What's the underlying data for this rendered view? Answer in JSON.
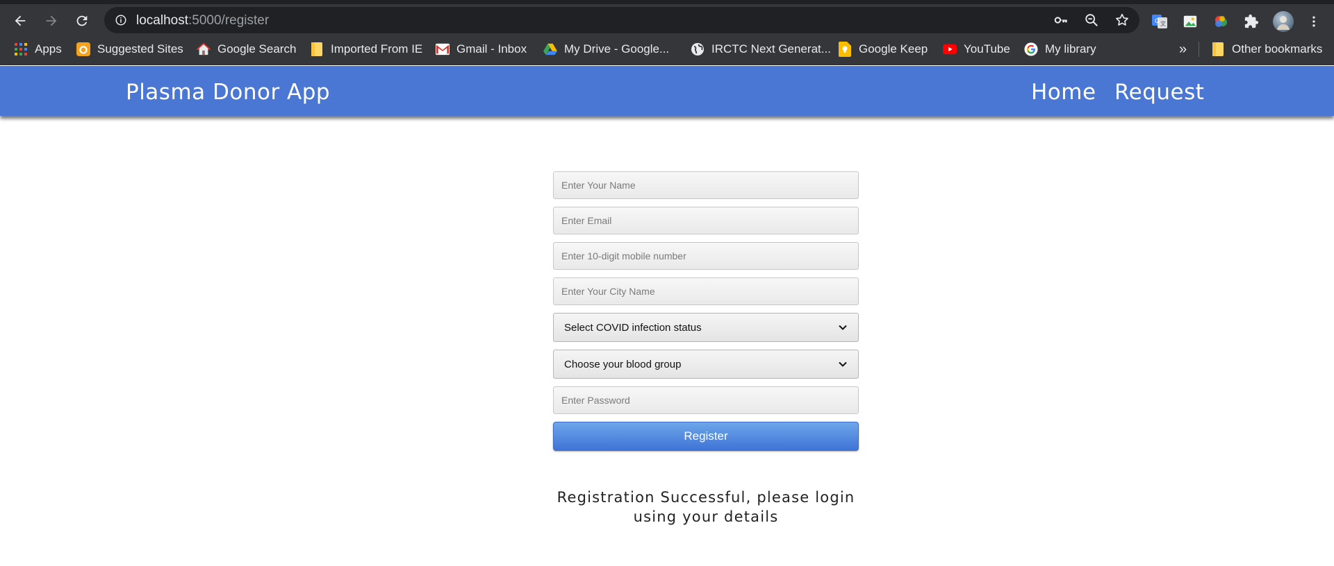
{
  "browser": {
    "url_host": "localhost",
    "url_path": ":5000/register"
  },
  "bookmarks": {
    "items": [
      {
        "label": "Apps",
        "icon": "apps-grid-icon"
      },
      {
        "label": "Suggested Sites",
        "icon": "bing-icon"
      },
      {
        "label": "Google Search",
        "icon": "home-icon"
      },
      {
        "label": "Imported From IE",
        "icon": "folder-icon"
      },
      {
        "label": "Gmail - Inbox",
        "icon": "gmail-icon"
      },
      {
        "label": "My Drive - Google...",
        "icon": "google-drive-icon"
      },
      {
        "label": "IRCTC Next Generat...",
        "icon": "globe-icon"
      },
      {
        "label": "Google Keep",
        "icon": "google-keep-icon"
      },
      {
        "label": "YouTube",
        "icon": "youtube-icon"
      },
      {
        "label": "My library",
        "icon": "google-icon"
      }
    ],
    "overflow_label": "»",
    "other_label": "Other bookmarks"
  },
  "app": {
    "brand": "Plasma Donor App",
    "nav": [
      {
        "label": "Home"
      },
      {
        "label": "Request"
      }
    ]
  },
  "form": {
    "name_placeholder": "Enter Your Name",
    "email_placeholder": "Enter Email",
    "mobile_placeholder": "Enter 10-digit mobile number",
    "city_placeholder": "Enter Your City Name",
    "covid_select": "Select COVID infection status",
    "blood_select": "Choose your blood group",
    "password_placeholder": "Enter Password",
    "register_label": "Register"
  },
  "message": {
    "line1": "Registration Successful, please login",
    "line2": "using your details"
  },
  "colors": {
    "navbar": "#4a76d4",
    "chrome": "#35363a",
    "button": "#3f74d6"
  }
}
